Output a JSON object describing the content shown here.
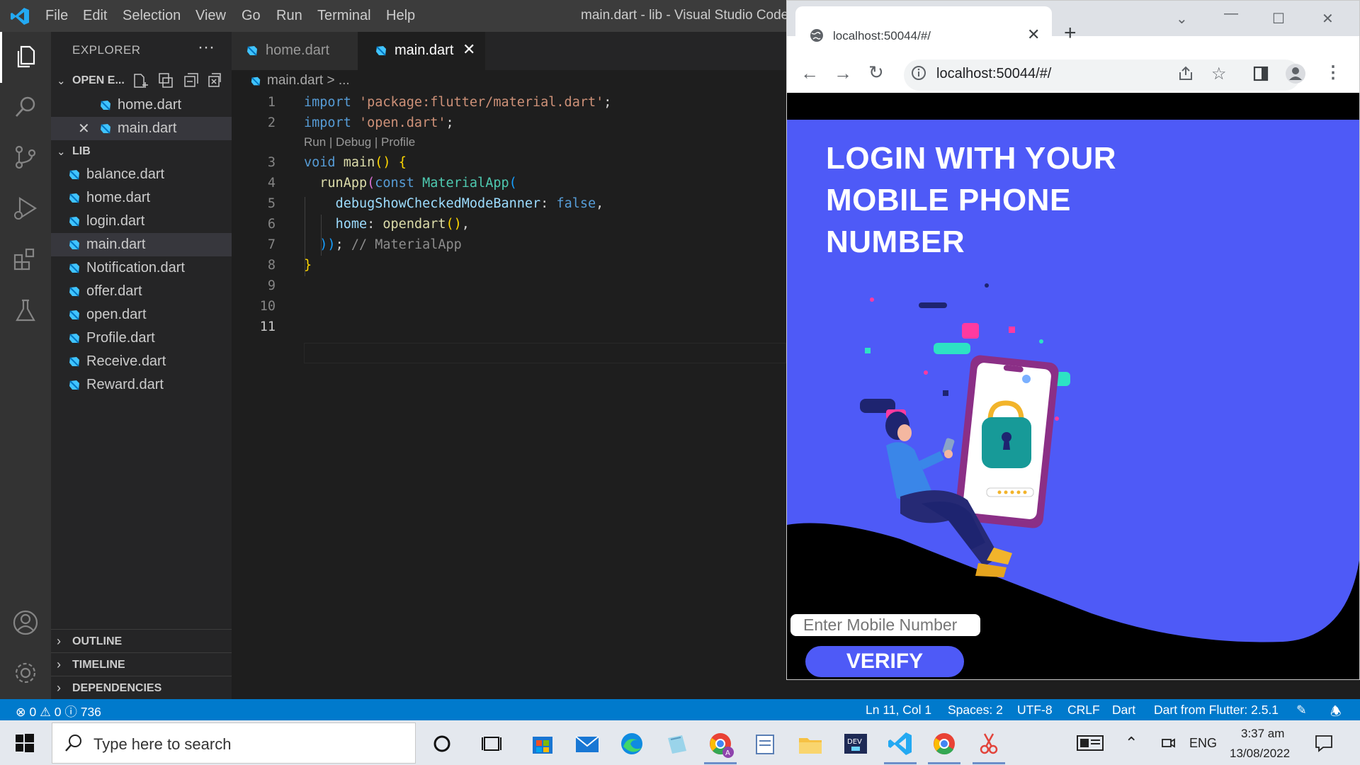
{
  "vscode": {
    "menu": [
      "File",
      "Edit",
      "Selection",
      "View",
      "Go",
      "Run",
      "Terminal",
      "Help"
    ],
    "window_title": "main.dart - lib - Visual Studio Code",
    "sidebar": {
      "title": "EXPLORER",
      "more": "···",
      "open_editors_label": "OPEN E...",
      "open_editors": [
        "home.dart",
        "main.dart"
      ],
      "lib_label": "LIB",
      "lib_files": [
        "balance.dart",
        "home.dart",
        "login.dart",
        "main.dart",
        "Notification.dart",
        "offer.dart",
        "open.dart",
        "Profile.dart",
        "Receive.dart",
        "Reward.dart"
      ],
      "sections": [
        "OUTLINE",
        "TIMELINE",
        "DEPENDENCIES"
      ]
    },
    "tabs": [
      {
        "label": "home.dart",
        "active": false
      },
      {
        "label": "main.dart",
        "active": true
      }
    ],
    "breadcrumb": "main.dart > ...",
    "codelens": "Run | Debug | Profile",
    "line_numbers": [
      "1",
      "2",
      "3",
      "4",
      "5",
      "6",
      "7",
      "8",
      "9",
      "10",
      "11"
    ],
    "code": {
      "l1_kw": "import",
      "l1_str": "'package:flutter/material.dart'",
      "l1_end": ";",
      "l2_kw": "import",
      "l2_str": "'open.dart'",
      "l2_end": ";",
      "l3_kw": "void",
      "l3_fn": "main",
      "l3_paren": "()",
      "l3_brace": "{",
      "l4_fn": "runApp",
      "l4_paren": "(",
      "l4_kw": "const",
      "l4_cls": "MaterialApp",
      "l4_paren2": "(",
      "l5_prop": "debugShowCheckedModeBanner",
      "l5_colon": ":",
      "l5_val": "false",
      "l5_comma": ",",
      "l6_prop": "home",
      "l6_colon": ":",
      "l6_fn": "opendart",
      "l6_paren": "()",
      "l6_comma": ",",
      "l7_close": "))",
      "l7_semi": ";",
      "l7_cmt": "// MaterialApp",
      "l8_brace": "}"
    },
    "status": {
      "errors": "0",
      "warnings": "0",
      "infos": "736",
      "position": "Ln 11, Col 1",
      "spaces": "Spaces: 2",
      "encoding": "UTF-8",
      "eol": "CRLF",
      "language": "Dart",
      "sdk": "Dart from Flutter: 2.5.1"
    }
  },
  "browser": {
    "tab_title": "localhost:50044/#/",
    "url": "localhost:50044/#/",
    "app": {
      "title_lines": [
        "LOGIN WITH YOUR",
        "MOBILE PHONE",
        "NUMBER"
      ],
      "input_placeholder": "Enter Mobile Number",
      "verify_label": "VERIFY",
      "colors": {
        "primary": "#4e5af7",
        "background": "#000000"
      }
    }
  },
  "taskbar": {
    "search_placeholder": "Type here to search",
    "language": "ENG",
    "time": "3:37 am",
    "date": "13/08/2022"
  },
  "icons": [
    "explorer-icon",
    "search-icon",
    "source-control-icon",
    "run-debug-icon",
    "extensions-icon",
    "testing-icon",
    "account-icon",
    "settings-gear-icon"
  ]
}
